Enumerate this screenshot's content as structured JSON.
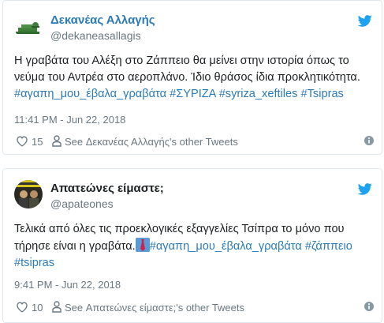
{
  "tweets": [
    {
      "display_name": "Δεκανέας Αλλαγής",
      "screen_name": "@dekaneasallagis",
      "text_plain": "Η γραβάτα του Αλέξη στο Ζάππειο θα μείνει στην ιστορία όπως το νεύμα του Αντρέα στο αεροπλάνο. Ίδιο θράσος ίδια προκλητικότητα.",
      "hashtags": [
        "#αγαπη_μου_έβαλα_γραβάτα",
        "#ΣΥΡΙΖΑ",
        "#syriza_xeftiles",
        "#Tsipras"
      ],
      "timestamp": "11:41 PM - Jun 22, 2018",
      "like_count": "15",
      "profile_link": "See Δεκανέας Αλλαγής's other Tweets"
    },
    {
      "display_name": "Απατεώνες είμαστε;",
      "screen_name": "@apateones",
      "text_line1": "Τελικά από όλες τις προεκλογικές εξαγγελίες Τσίπρα το μόνο που",
      "text_line2_start": "τήρησε είναι η γραβάτα.",
      "hashtags": [
        "#αγαπη_μου_έβαλα_γραβάτα",
        "#ζάππειο",
        "#tsipras"
      ],
      "timestamp": "9:41 PM - Jun 22, 2018",
      "like_count": "10",
      "profile_link": "See Απατεώνες είμαστε;'s other Tweets"
    }
  ],
  "colors": {
    "link_blue": "#2b7bb9",
    "twitter_blue": "#1da1f2",
    "meta_gray": "#697882",
    "border": "#e1e8ed"
  },
  "icons": {
    "bird": "twitter-bird-icon",
    "like": "heart-icon",
    "profile": "person-icon",
    "info": "info-icon",
    "tie": "necktie-emoji"
  }
}
